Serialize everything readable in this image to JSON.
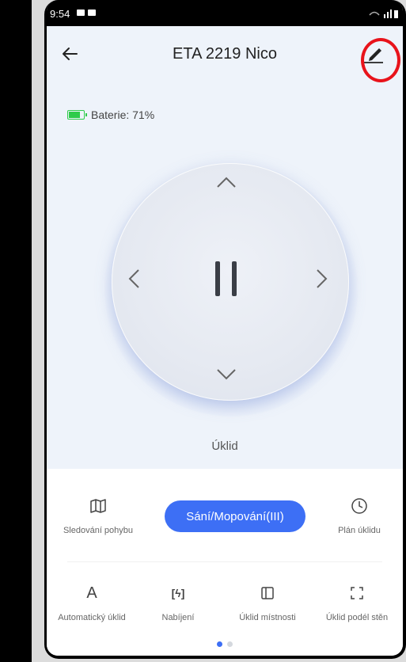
{
  "status_bar": {
    "time": "9:54"
  },
  "header": {
    "title": "ETA 2219 Nico"
  },
  "battery": {
    "label": "Baterie: 71%",
    "level_percent": 71,
    "color": "#2ecb4a"
  },
  "control": {
    "status": "Úklid",
    "center_icon": "pause-icon"
  },
  "actions_row1": [
    {
      "label": "Sledování pohybu",
      "icon": "map-icon"
    },
    {
      "label": "Sání/Mopování(III)",
      "icon": null
    },
    {
      "label": "Plán úklidu",
      "icon": "clock-icon"
    }
  ],
  "actions_row2": [
    {
      "label": "Automatický úklid",
      "icon": "auto-icon",
      "glyph": "A"
    },
    {
      "label": "Nabíjení",
      "icon": "charging-icon",
      "glyph": "[ϟ]"
    },
    {
      "label": "Úklid místnosti",
      "icon": "room-icon"
    },
    {
      "label": "Úklid podél stěn",
      "icon": "edge-icon"
    }
  ],
  "pagination": {
    "pages": 2,
    "current": 1
  },
  "colors": {
    "accent": "#3d6ff5",
    "highlight_circle": "#e8131b"
  }
}
